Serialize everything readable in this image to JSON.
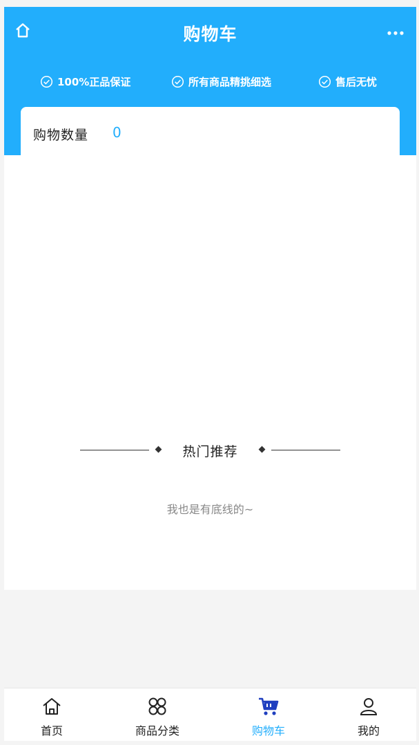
{
  "header": {
    "title": "购物车",
    "home_icon": "home-icon",
    "more_icon": "more-dots-icon"
  },
  "guarantees": [
    {
      "label": "100%正品保证",
      "icon": "check-circle-icon"
    },
    {
      "label": "所有商品精挑细选",
      "icon": "check-circle-icon"
    },
    {
      "label": "售后无忧",
      "icon": "check-circle-icon"
    }
  ],
  "cart": {
    "count_label": "购物数量",
    "count_value": "0"
  },
  "recommend": {
    "title": "热门推荐",
    "bottom_text": "我也是有底线的~"
  },
  "tabbar": {
    "items": [
      {
        "label": "首页",
        "icon": "home-icon"
      },
      {
        "label": "商品分类",
        "icon": "category-grid-icon"
      },
      {
        "label": "购物车",
        "icon": "cart-icon",
        "active": true
      },
      {
        "label": "我的",
        "icon": "user-icon"
      }
    ]
  },
  "colors": {
    "primary": "#22aefc",
    "active_cart_icon": "#1f3fbf",
    "background": "#f4f4f4"
  }
}
